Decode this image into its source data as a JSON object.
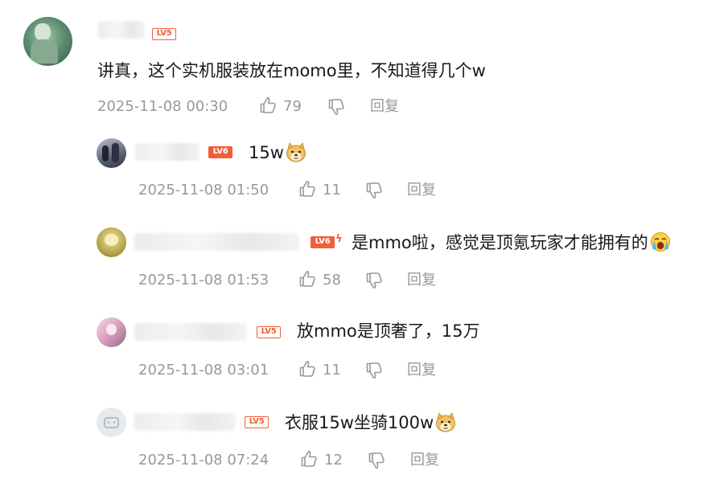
{
  "comments": [
    {
      "level": "LV5",
      "text": "讲真，这个实机服装放在momo里，不知道得几个w",
      "emoji": "",
      "time": "2025-11-08 00:30",
      "likes": "79",
      "reply_label": "回复"
    }
  ],
  "replies": [
    {
      "level": "LV6",
      "text": "15w",
      "emoji": "doge-100-icon",
      "time": "2025-11-08 01:50",
      "likes": "11",
      "reply_label": "回复"
    },
    {
      "level": "LV6",
      "text": "是mmo啦，感觉是顶氪玩家才能拥有的",
      "emoji": "crying-face-icon",
      "time": "2025-11-08 01:53",
      "likes": "58",
      "reply_label": "回复"
    },
    {
      "level": "LV5",
      "text": "放mmo是顶奢了，15万",
      "emoji": "",
      "time": "2025-11-08 03:01",
      "likes": "11",
      "reply_label": "回复"
    },
    {
      "level": "LV5",
      "text": "衣服15w坐骑100w",
      "emoji": "doge-icon",
      "time": "2025-11-08 07:24",
      "likes": "12",
      "reply_label": "回复"
    }
  ],
  "colors": {
    "level_badge": "#f25d3a",
    "meta_text": "#9499a0",
    "comment_text": "#18191c"
  }
}
